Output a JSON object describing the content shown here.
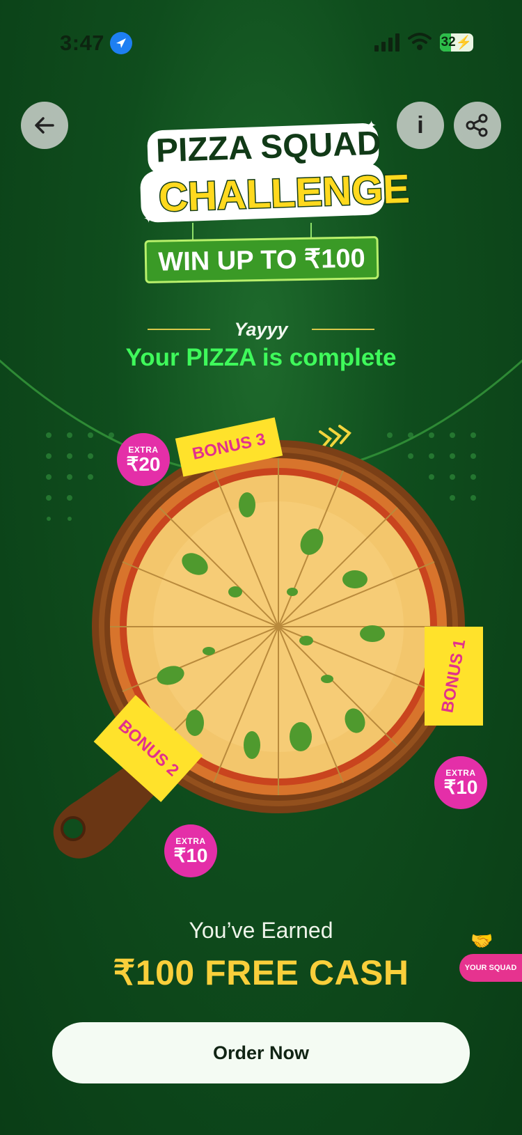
{
  "status_bar": {
    "time": "3:47",
    "battery": "32"
  },
  "header": {
    "back_icon": "arrow-left-icon",
    "info_label": "i",
    "share_icon": "share-icon"
  },
  "logo": {
    "line1": "PIZZA SQUAD",
    "line2": "CHALLENGE",
    "banner": "WIN UP TO ₹100"
  },
  "headline": {
    "small": "Yayyy",
    "main": "Your PIZZA is complete"
  },
  "bonuses": [
    {
      "label": "BONUS 3",
      "extra_label": "EXTRA",
      "extra_value": "₹20"
    },
    {
      "label": "BONUS 1",
      "extra_label": "EXTRA",
      "extra_value": "₹10"
    },
    {
      "label": "BONUS 2",
      "extra_label": "EXTRA",
      "extra_value": "₹10"
    }
  ],
  "earned": {
    "label": "You’ve Earned",
    "amount": "₹100 FREE CASH"
  },
  "squad_tab": {
    "label": "YOUR SQUAD"
  },
  "cta": {
    "label": "Order Now"
  },
  "colors": {
    "background": "#0f4d1d",
    "accent_green": "#3ff95b",
    "accent_yellow": "#f9cf3b",
    "bonus_pink": "#e42fa8",
    "flag_yellow": "#ffe22b"
  }
}
